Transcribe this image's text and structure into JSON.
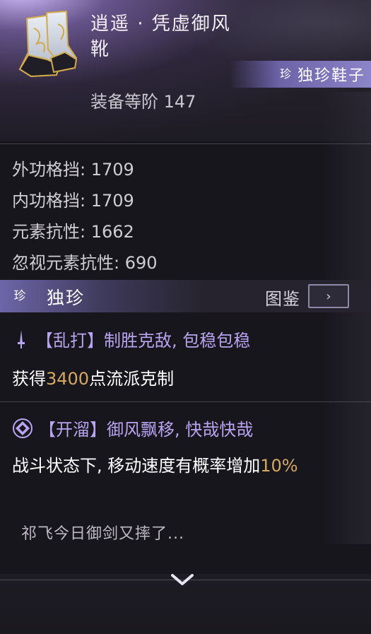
{
  "item": {
    "name_line1": "逍遥 · 凭虚御风",
    "name_line2": "靴",
    "rarity_gem": "珍",
    "rarity_label": "独珍鞋子",
    "level_text": "装备等阶 147"
  },
  "stats": [
    {
      "text": "外功格挡: 1709"
    },
    {
      "text": "内功格挡: 1709"
    },
    {
      "text": "元素抗性: 1662"
    },
    {
      "text": "忽视元素抗性: 690"
    }
  ],
  "section": {
    "gem": "珍",
    "label": "独珍",
    "atlas_label": "图鉴",
    "atlas_arrow": "›"
  },
  "skills": [
    {
      "icon": "dagger-icon",
      "title": "【乱打】制胜克敌, 包稳包稳",
      "desc_prefix": "获得",
      "desc_value": "3400",
      "desc_suffix": "点流派克制"
    },
    {
      "icon": "diamond-icon",
      "title": "【开溜】御风飘移, 快哉快哉",
      "desc_prefix": "战斗状态下, 移动速度有概率增加",
      "desc_value": "10%",
      "desc_suffix": ""
    }
  ],
  "flavor": "祁飞今日御剑又摔了...",
  "colors": {
    "accent_purple": "#b8a4f0",
    "value_gold": "#d6a860",
    "banner": "#8c84c8"
  }
}
